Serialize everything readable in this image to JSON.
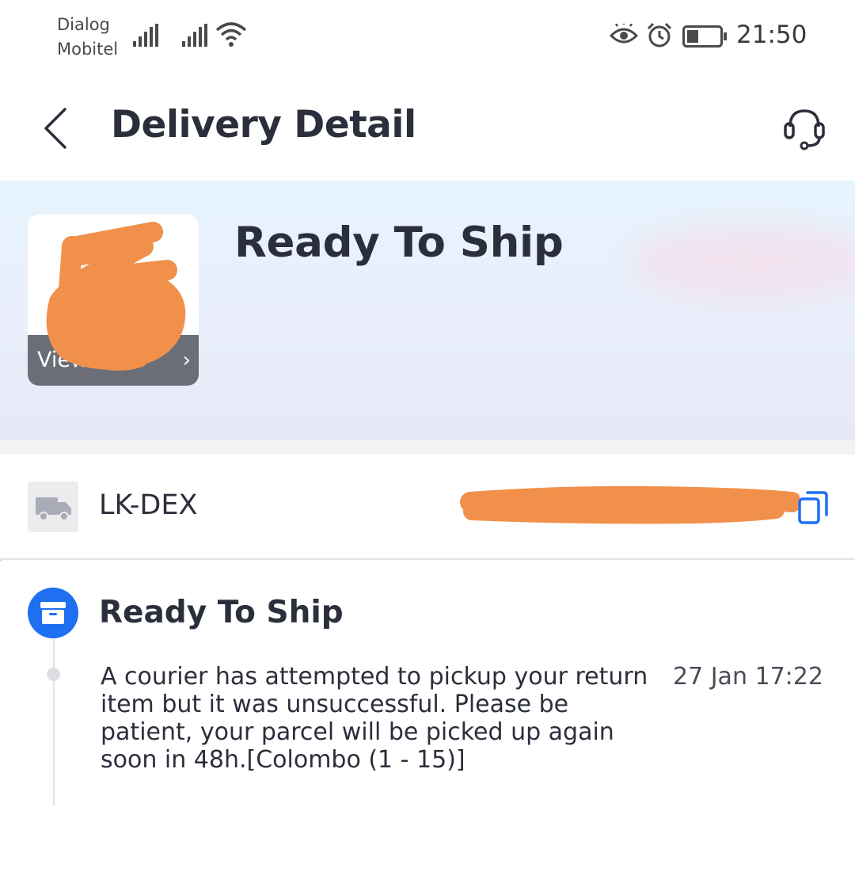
{
  "status_bar": {
    "carrier_line1": "Dialog",
    "carrier_line2": "Mobitel",
    "time": "21:50",
    "icons": [
      "signal-icon",
      "signal-icon",
      "wifi-icon",
      "eye-comfort-icon",
      "alarm-icon",
      "battery-icon"
    ]
  },
  "header": {
    "title": "Delivery Detail",
    "back_icon": "chevron-left-icon",
    "support_icon": "headset-icon"
  },
  "hero": {
    "status": "Ready To Ship",
    "thumbnail_label": "View",
    "thumbnail_arrow": "›"
  },
  "courier": {
    "name": "LK-DEX",
    "truck_icon": "truck-icon",
    "copy_icon": "copy-icon"
  },
  "timeline": {
    "events": [
      {
        "title": "Ready To Ship",
        "icon": "box-icon",
        "description": "A courier has attempted to pickup your return item but it was unsuccessful. Please be patient, your parcel will be picked up again soon in 48h.[Colombo (1 - 15)]",
        "time": "27 Jan 17:22"
      }
    ]
  },
  "colors": {
    "accent_blue": "#1e6ff2",
    "redaction_orange": "#f0904a",
    "text_dark": "#2b2f3b"
  }
}
